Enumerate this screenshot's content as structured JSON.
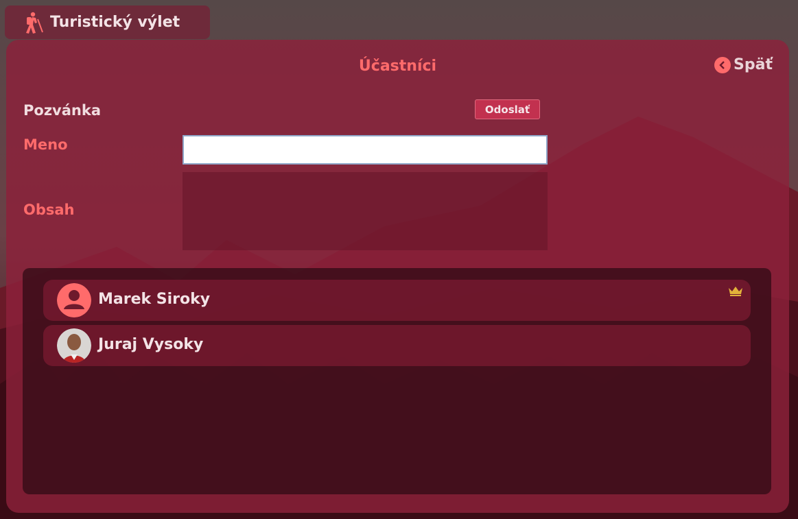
{
  "app": {
    "title": "Turistický výlet",
    "icon": "hiker-icon"
  },
  "panel": {
    "title": "Účastníci",
    "back_label": "Späť",
    "back_icon": "chevron-left-icon"
  },
  "invite": {
    "heading": "Pozvánka",
    "send_label": "Odoslať",
    "name_label": "Meno",
    "name_value": "",
    "content_label": "Obsah",
    "content_value": ""
  },
  "participants": [
    {
      "name": "Marek Siroky",
      "avatar": "default-user-icon",
      "is_owner": true
    },
    {
      "name": "Juraj Vysoky",
      "avatar": "photo"
    }
  ],
  "colors": {
    "accent": "#ff6b6b",
    "panel": "#8c213a",
    "button": "#c2314f",
    "crown": "#e2b23a"
  }
}
